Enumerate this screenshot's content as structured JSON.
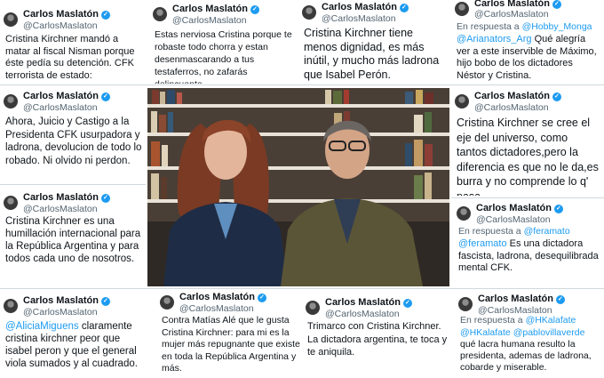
{
  "user": {
    "name": "Carlos Maslatón",
    "handle": "@CarlosMaslaton"
  },
  "icons": {
    "verified": "verified-badge-icon",
    "avatar": "profile-avatar"
  },
  "colors": {
    "link": "#1d9bf0",
    "muted": "#536471",
    "text": "#0f1419"
  },
  "tweets": [
    {
      "text": "Cristina Kirchner mandó a matar al fiscal Nisman porque éste pedía su detención. CFK terrorista de estado:"
    },
    {
      "text": "Estas nerviosa Cristina porque te robaste todo chorra y estan desenmascarando a tus testaferros, no zafarás delincuente."
    },
    {
      "text": "Cristina Kirchner tiene menos dignidad, es más inútil, y mucho más ladrona que Isabel Perón."
    },
    {
      "reply_prefix": "En respuesta a",
      "reply_to": "@Hobby_Monga",
      "mention": "@Arianators_Arg",
      "text": " Qué alegría ver a este inservible de Máximo, hijo bobo de los dictadores Néstor y Cristina."
    },
    {
      "text": "Ahora, Juicio y Castigo a la Presidenta CFK usurpadora y ladrona, devolucion de todo lo robado. Ni olvido ni perdon."
    },
    {
      "text": "Cristina Kirchner se cree el eje del universo, como tantos dictadores,pero la diferencia es que no le da,es burra y no comprende lo q' pasa."
    },
    {
      "text": "Cristina Kirchner es una humillación internacional para la República Argentina y para todos cada uno de nosotros."
    },
    {
      "reply_prefix": "En respuesta a",
      "reply_to": "@feramato",
      "mention": "@feramato",
      "text": " Es una dictadora fascista, ladrona, desequilibrada mental CFK."
    },
    {
      "mention": "@AliciaMiguens",
      "text": " claramente cristina kirchner peor que isabel peron y que el general viola sumados y al cuadrado."
    },
    {
      "text": "Contra Matías Alé que le gusta Cristina Kirchner: para mi es la mujer más repugnante que existe en toda la República Argentina y más."
    },
    {
      "text": "Trimarco con Cristina Kirchner. La dictadora argentina, te toca y te aniquila."
    },
    {
      "reply_prefix": "En respuesta a",
      "reply_to": "@HKalafate",
      "mention": "@HKalafate",
      "mention2": "@pablovillaverde",
      "text": " qué lacra humana resulto la presidenta, ademas de ladrona, cobarde y miserable."
    }
  ]
}
